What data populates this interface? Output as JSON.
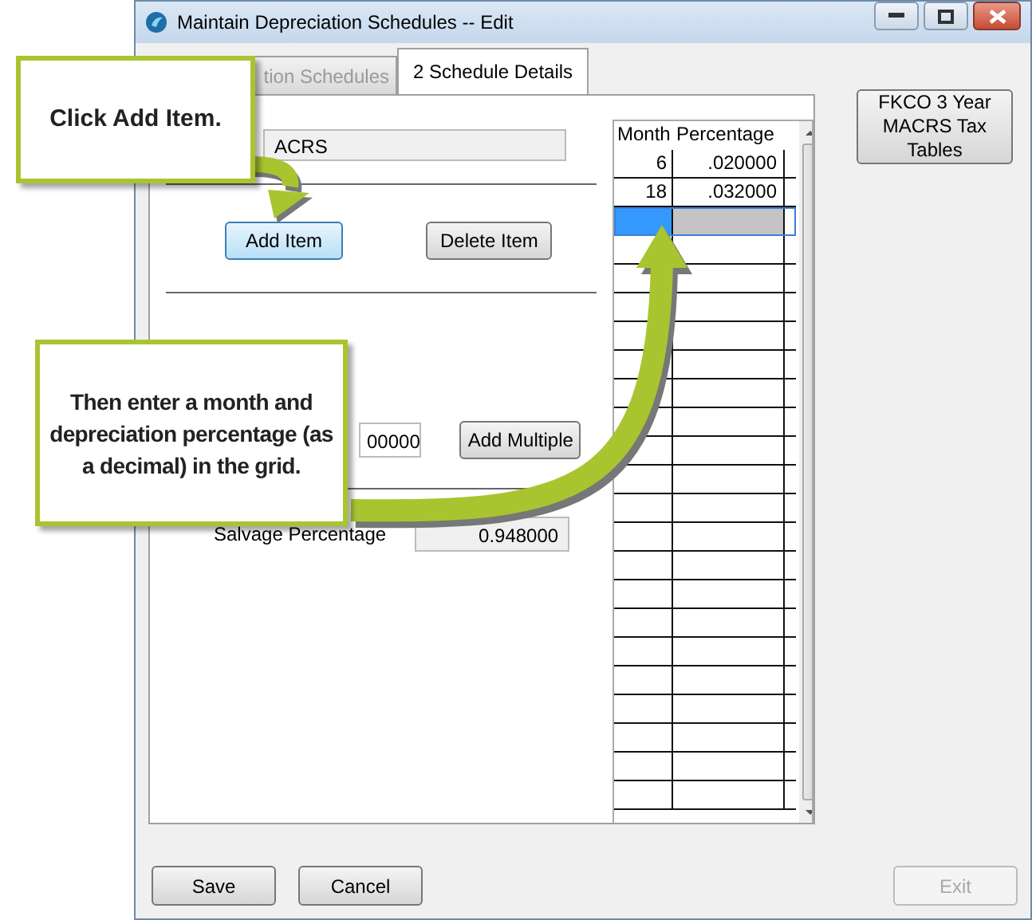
{
  "window": {
    "title": "Maintain Depreciation Schedules -- Edit"
  },
  "tabs": [
    {
      "label": "tion Schedules",
      "selected": false
    },
    {
      "label": "2 Schedule Details",
      "selected": true
    }
  ],
  "form": {
    "name_field": "ACRS",
    "buttons": [
      {
        "label": "Add Item",
        "focused": true
      },
      {
        "label": "Delete Item",
        "focused": false
      }
    ],
    "amount_field": "00000",
    "add_multiple": "Add Multiple",
    "salvage": {
      "label": "Salvage Percentage",
      "value": "0.948000"
    }
  },
  "grid": {
    "columns": [
      "Month",
      "Percentage"
    ],
    "rows": [
      {
        "month": "6",
        "percentage": ".020000",
        "selected": false
      },
      {
        "month": "18",
        "percentage": ".032000",
        "selected": false
      },
      {
        "selected": true
      }
    ]
  },
  "side_button": "FKCO 3 Year MACRS Tax Tables",
  "footer": {
    "left": [
      {
        "label": "Save",
        "disabled": false
      },
      {
        "label": "Cancel",
        "disabled": false
      }
    ],
    "right": [
      {
        "label": "Exit",
        "disabled": true
      }
    ]
  },
  "callouts": [
    {
      "text": "Click Add Item."
    },
    {
      "text": "Then enter a month and depreciation percentage (as a decimal) in the grid."
    }
  ]
}
